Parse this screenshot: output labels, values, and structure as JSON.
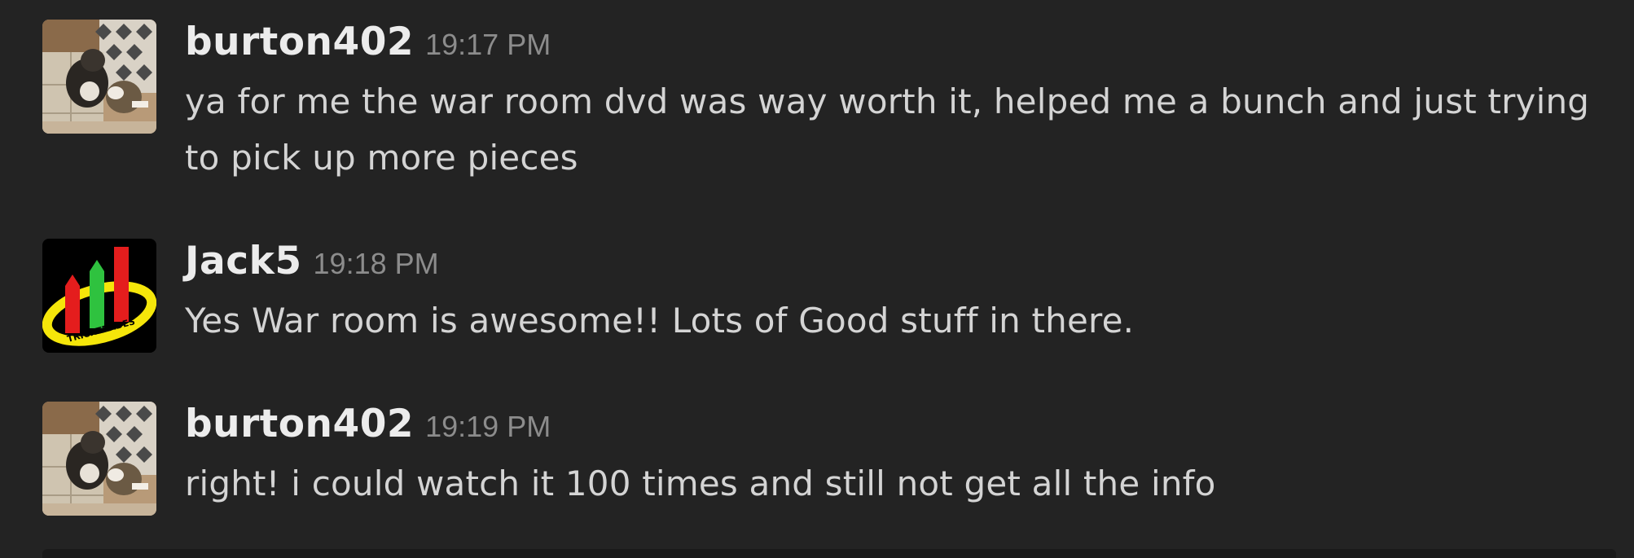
{
  "messages": [
    {
      "username": "burton402",
      "timestamp": "19:17 PM",
      "text": "ya for me the war room dvd was way worth it, helped me a bunch and just trying to pick up more pieces",
      "avatar": "dog-photo-avatar"
    },
    {
      "username": "Jack5",
      "timestamp": "19:18 PM",
      "text": "Yes War room is awesome!! Lots of Good stuff in there.",
      "avatar": "tricktrades-logo-avatar",
      "avatar_text": "TRICKTRADES"
    },
    {
      "username": "burton402",
      "timestamp": "19:19 PM",
      "text": "right! i could watch it 100 times and still not get all the info",
      "avatar": "dog-photo-avatar"
    }
  ],
  "colors": {
    "background": "#232323",
    "username": "#ececec",
    "timestamp": "#8c8c8c",
    "message_text": "#d4d4d4"
  }
}
